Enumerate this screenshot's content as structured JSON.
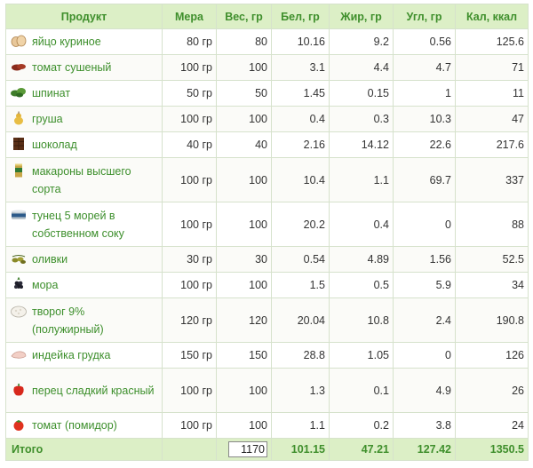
{
  "header": {
    "product": "Продукт",
    "measure": "Мера",
    "weight": "Вес, гр",
    "protein": "Бел, гр",
    "fat": "Жир, гр",
    "carbs": "Угл, гр",
    "calories": "Кал, ккал"
  },
  "rows": [
    {
      "name": "яйцо куриное",
      "icon": "egg-icon",
      "measure": "80 гр",
      "weight": "80",
      "protein": "10.16",
      "fat": "9.2",
      "carbs": "0.56",
      "calories": "125.6"
    },
    {
      "name": "томат сушеный",
      "icon": "dried-tomato-icon",
      "measure": "100 гр",
      "weight": "100",
      "protein": "3.1",
      "fat": "4.4",
      "carbs": "4.7",
      "calories": "71"
    },
    {
      "name": "шпинат",
      "icon": "spinach-icon",
      "measure": "50 гр",
      "weight": "50",
      "protein": "1.45",
      "fat": "0.15",
      "carbs": "1",
      "calories": "11"
    },
    {
      "name": "груша",
      "icon": "pear-icon",
      "measure": "100 гр",
      "weight": "100",
      "protein": "0.4",
      "fat": "0.3",
      "carbs": "10.3",
      "calories": "47"
    },
    {
      "name": "шоколад",
      "icon": "chocolate-icon",
      "measure": "40 гр",
      "weight": "40",
      "protein": "2.16",
      "fat": "14.12",
      "carbs": "22.6",
      "calories": "217.6"
    },
    {
      "name": "макароны высшего сорта",
      "icon": "pasta-icon",
      "measure": "100 гр",
      "weight": "100",
      "protein": "10.4",
      "fat": "1.1",
      "carbs": "69.7",
      "calories": "337"
    },
    {
      "name": "тунец 5 морей в собственном соку",
      "icon": "tuna-can-icon",
      "measure": "100 гр",
      "weight": "100",
      "protein": "20.2",
      "fat": "0.4",
      "carbs": "0",
      "calories": "88"
    },
    {
      "name": "оливки",
      "icon": "olives-icon",
      "measure": "30 гр",
      "weight": "30",
      "protein": "0.54",
      "fat": "4.89",
      "carbs": "1.56",
      "calories": "52.5"
    },
    {
      "name": "мора",
      "icon": "blackberry-icon",
      "measure": "100 гр",
      "weight": "100",
      "protein": "1.5",
      "fat": "0.5",
      "carbs": "5.9",
      "calories": "34"
    },
    {
      "name": "творог 9% (полужирный)",
      "icon": "cottage-cheese-icon",
      "measure": "120 гр",
      "weight": "120",
      "protein": "20.04",
      "fat": "10.8",
      "carbs": "2.4",
      "calories": "190.8"
    },
    {
      "name": "индейка грудка",
      "icon": "turkey-breast-icon",
      "measure": "150 гр",
      "weight": "150",
      "protein": "28.8",
      "fat": "1.05",
      "carbs": "0",
      "calories": "126"
    },
    {
      "name": "перец сладкий красный",
      "icon": "red-pepper-icon",
      "measure": "100 гр",
      "weight": "100",
      "protein": "1.3",
      "fat": "0.1",
      "carbs": "4.9",
      "calories": "26"
    },
    {
      "name": "томат (помидор)",
      "icon": "tomato-icon",
      "measure": "100 гр",
      "weight": "100",
      "protein": "1.1",
      "fat": "0.2",
      "carbs": "3.8",
      "calories": "24"
    }
  ],
  "total": {
    "label": "Итого",
    "weight": "1170",
    "protein": "101.15",
    "fat": "47.21",
    "carbs": "127.42",
    "calories": "1350.5"
  },
  "colors": {
    "header_bg": "#dcefc6",
    "accent_green": "#3f8f2c",
    "border": "#d6e2cc"
  }
}
